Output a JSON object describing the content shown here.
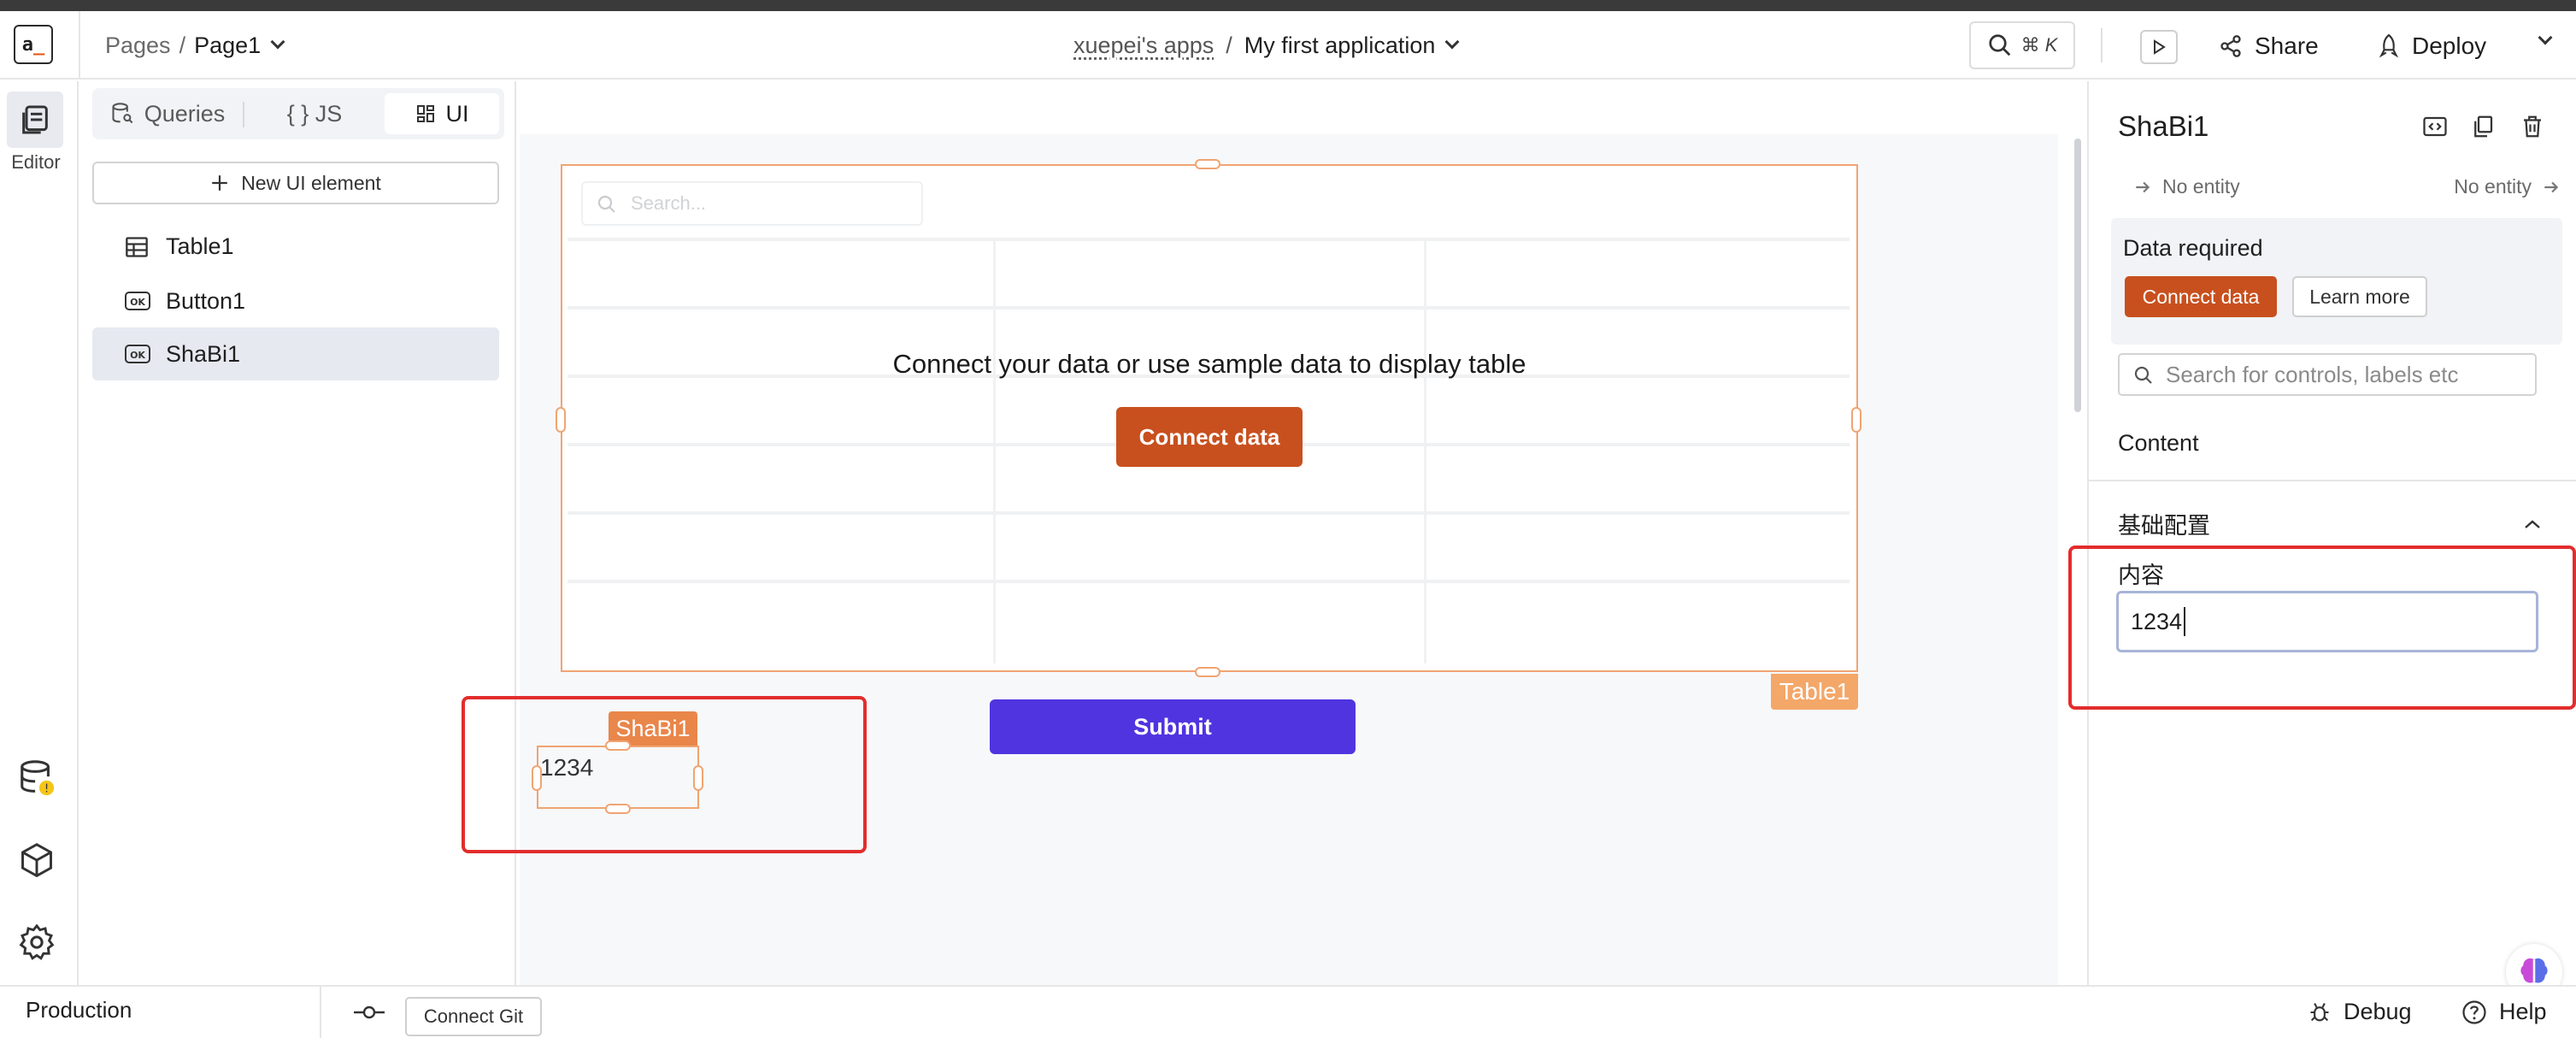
{
  "header": {
    "logo_text": "a",
    "breadcrumb_root": "Pages",
    "breadcrumb_sep": "/",
    "breadcrumb_current": "Page1",
    "workspace": "xuepei's apps",
    "app_sep": "/",
    "app_name": "My first application",
    "search_shortcut": "⌘ K",
    "share_label": "Share",
    "deploy_label": "Deploy"
  },
  "rail": {
    "editor_label": "Editor"
  },
  "explorer": {
    "tabs": [
      {
        "label": "Queries"
      },
      {
        "label": "{ } JS"
      },
      {
        "label": "UI"
      }
    ],
    "new_ui_label": "New UI element",
    "items": [
      {
        "label": "Table1"
      },
      {
        "label": "Button1"
      },
      {
        "label": "ShaBi1"
      }
    ]
  },
  "canvas": {
    "table": {
      "search_placeholder": "Search...",
      "message": "Connect your data or use sample data to display table",
      "connect_label": "Connect data",
      "tag": "Table1"
    },
    "submit_label": "Submit",
    "shabi": {
      "tag": "ShaBi1",
      "text": "1234"
    }
  },
  "props": {
    "title": "ShaBi1",
    "prev_entity": "No entity",
    "next_entity": "No entity",
    "data_required": "Data required",
    "connect_label": "Connect data",
    "learn_more": "Learn more",
    "search_placeholder": "Search for controls, labels etc",
    "tab_content": "Content",
    "section_title": "基础配置",
    "field_label": "内容",
    "field_value": "1234"
  },
  "footer": {
    "environment": "Production",
    "connect_git": "Connect Git",
    "debug": "Debug",
    "help": "Help"
  },
  "colors": {
    "accent_orange": "#c8501e",
    "submit_purple": "#5034e0",
    "highlight_red": "#e22d2d",
    "selection_orange": "#f0a472"
  }
}
